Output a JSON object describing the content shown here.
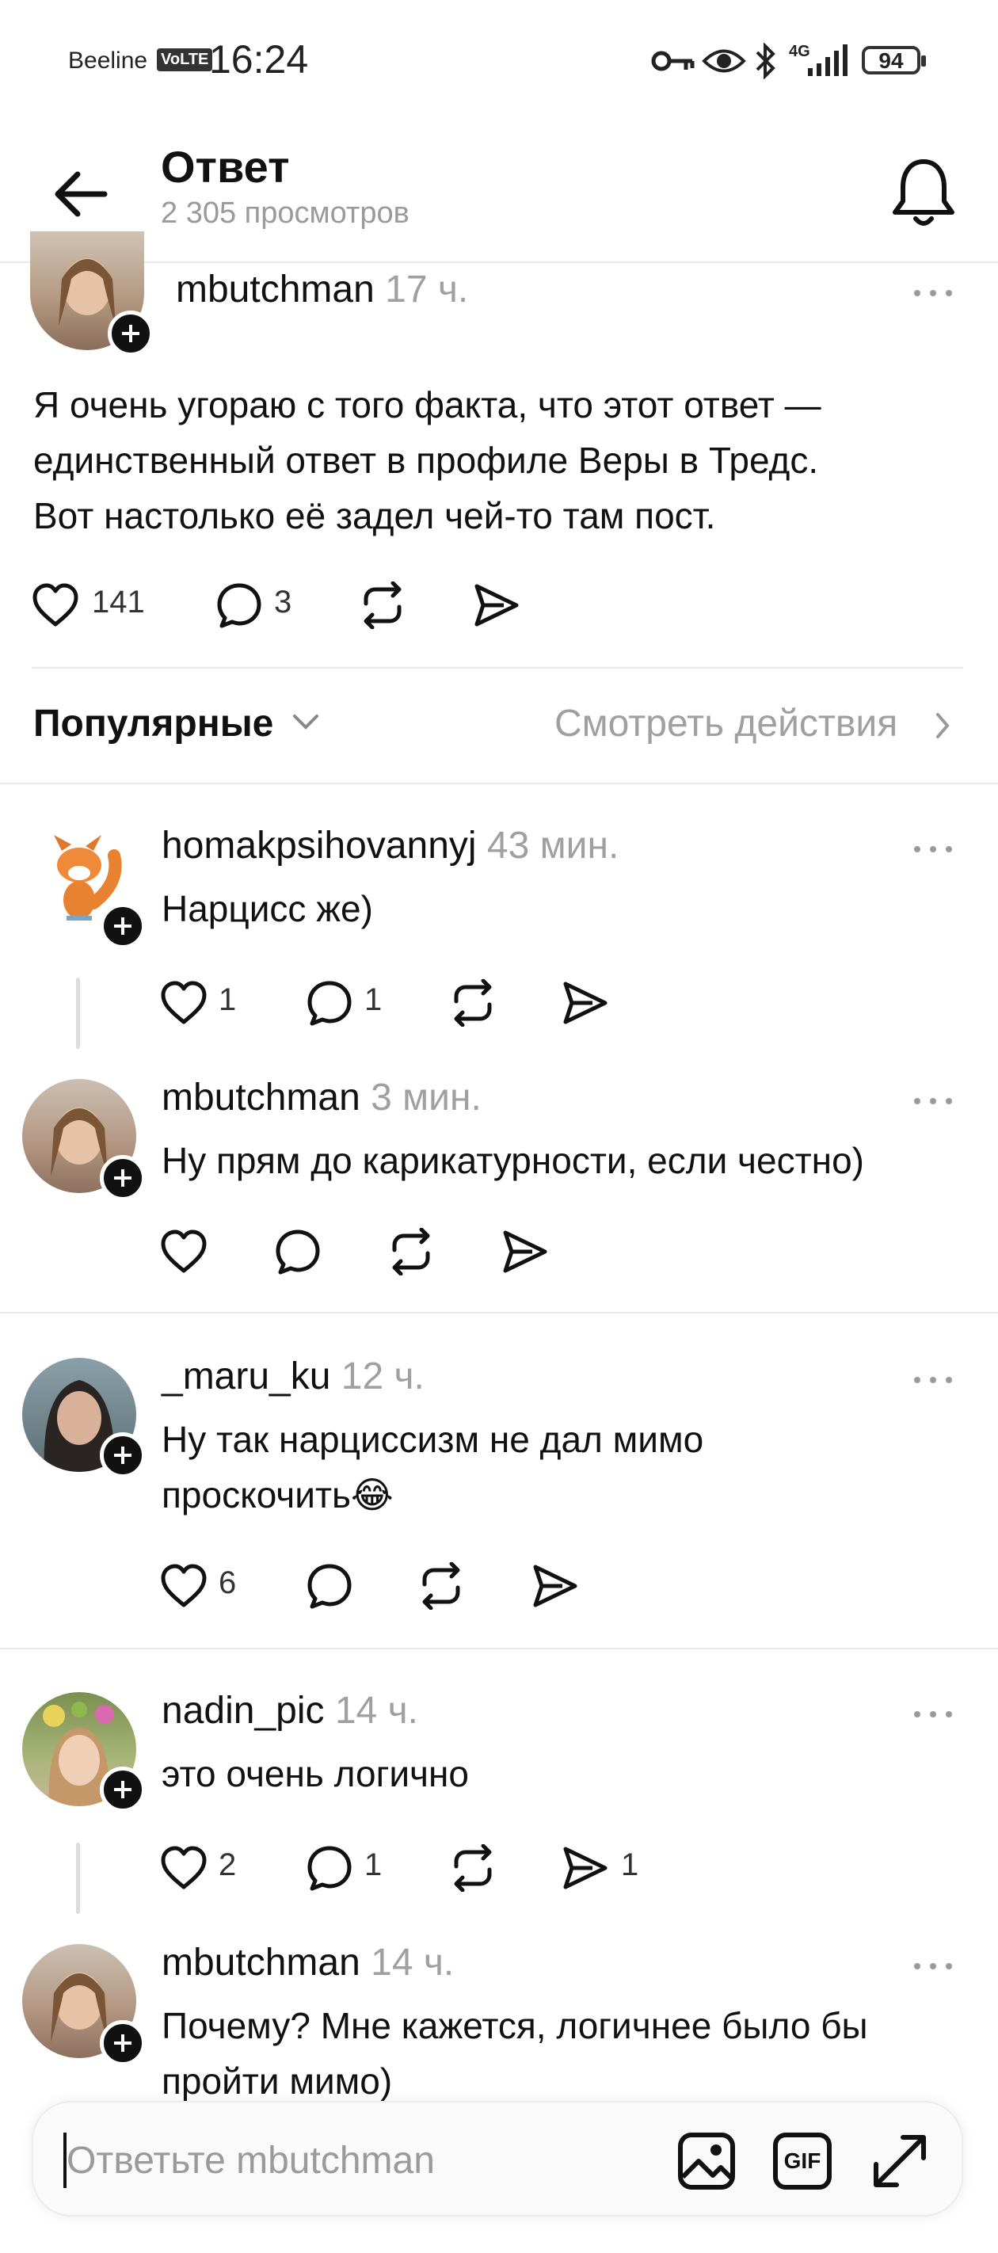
{
  "status_bar": {
    "carrier": "Beeline",
    "volte": "VoLTE",
    "time": "16:24",
    "network": "4G",
    "battery": "94"
  },
  "header": {
    "title": "Ответ",
    "views": "2 305 просмотров"
  },
  "post": {
    "username": "mbutchman",
    "time": "17 ч.",
    "text_lines": [
      "Я очень угораю с того факта, что этот ответ —",
      "единственный ответ в профиле Веры в Тредс.",
      "Вот настолько её задел чей-то там пост."
    ],
    "likes": "141",
    "replies": "3"
  },
  "sort": {
    "label": "Популярные",
    "activity": "Смотреть действия"
  },
  "comments": [
    {
      "username": "homakpsihovannyj",
      "time": "43 мин.",
      "lines": [
        "Нарцисс же)"
      ],
      "likes": "1",
      "replies": "1",
      "reposts": "",
      "shares": ""
    },
    {
      "username": "mbutchman",
      "time": "3 мин.",
      "lines": [
        "Ну прям до карикатурности, если честно)"
      ],
      "likes": "",
      "replies": "",
      "reposts": "",
      "shares": ""
    },
    {
      "username": "_maru_ku",
      "time": "12 ч.",
      "lines": [
        "Ну так нарциссизм не дал мимо",
        "проскочить😂"
      ],
      "likes": "6",
      "replies": "",
      "reposts": "",
      "shares": ""
    },
    {
      "username": "nadin_pic",
      "time": "14 ч.",
      "lines": [
        "это очень логично"
      ],
      "likes": "2",
      "replies": "1",
      "reposts": "",
      "shares": "1"
    },
    {
      "username": "mbutchman",
      "time": "14 ч.",
      "lines": [
        "Почему? Мне кажется, логичнее было бы",
        "пройти мимо)"
      ],
      "likes": "",
      "replies": "",
      "reposts": "",
      "shares": ""
    }
  ],
  "composer": {
    "placeholder": "Ответьте mbutchman",
    "gif_label": "GIF"
  },
  "icons": {
    "back": "arrow-left-icon",
    "bell": "bell-icon",
    "like": "heart-icon",
    "reply": "speech-bubble-icon",
    "repost": "repost-icon",
    "share": "send-icon",
    "image": "image-icon",
    "gif": "gif-icon",
    "expand": "expand-icon",
    "key": "key-icon",
    "eye": "eye-icon",
    "bluetooth": "bluetooth-icon",
    "signal": "signal-icon"
  },
  "colors": {
    "text": "#111111",
    "muted": "#9a9a9a",
    "divider": "#e8e8e8",
    "background": "#ffffff"
  }
}
